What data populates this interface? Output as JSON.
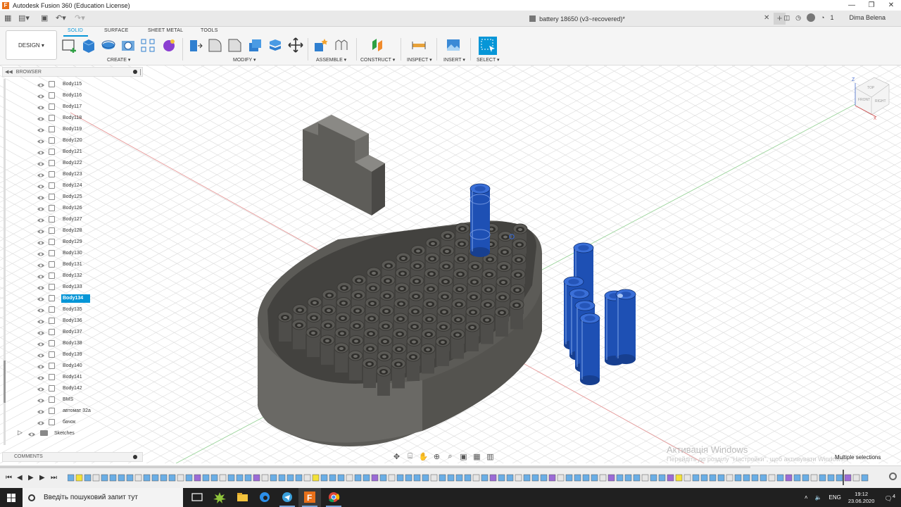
{
  "window": {
    "app_title": "Autodesk Fusion 360 (Education License)",
    "app_icon": "F",
    "minimize": "—",
    "maximize": "❐",
    "close": "✕"
  },
  "tabbar": {
    "doc_title": "battery 18650 (v3~recovered)*",
    "doc_close": "✕",
    "notif_count": "1",
    "user_name": "Dima Belena"
  },
  "toolbar": {
    "design_label": "DESIGN ▾",
    "workspace_tabs": [
      "SOLID",
      "SURFACE",
      "SHEET METAL",
      "TOOLS"
    ],
    "groups": [
      "CREATE ▾",
      "MODIFY ▾",
      "ASSEMBLE ▾",
      "CONSTRUCT ▾",
      "INSPECT ▾",
      "INSERT ▾",
      "SELECT ▾"
    ]
  },
  "browser": {
    "title": "BROWSER",
    "items": [
      "Body115",
      "Body116",
      "Body117",
      "Body118",
      "Body119",
      "Body120",
      "Body121",
      "Body122",
      "Body123",
      "Body124",
      "Body125",
      "Body126",
      "Body127",
      "Body128",
      "Body129",
      "Body130",
      "Body131",
      "Body132",
      "Body133",
      "Body134",
      "Body135",
      "Body136",
      "Body137",
      "Body138",
      "Body139",
      "Body140",
      "Body141",
      "Body142",
      "BMS",
      "автомат 32а",
      "бачок"
    ],
    "selected": "Body134",
    "folder": "Sketches"
  },
  "comments": {
    "title": "COMMENTS"
  },
  "viewcube": {
    "top": "TOP",
    "front": "FRONT",
    "right": "RIGHT",
    "axis_z": "Z",
    "axis_x": "X"
  },
  "watermark": {
    "line1": "Активація Windows",
    "line2": "Перейдіть до розділу \"Настройки\", щоб активувати Windows."
  },
  "status": {
    "multi_selection": "Multiple selections"
  },
  "taskbar": {
    "search_placeholder": "Введіть пошуковий запит тут",
    "language": "ENG",
    "time": "19:12",
    "date": "23.06.2020",
    "notif": "4"
  },
  "colors": {
    "accent": "#0696d7",
    "body_gray": "#5a5955",
    "battery_blue": "#1e50b4"
  }
}
